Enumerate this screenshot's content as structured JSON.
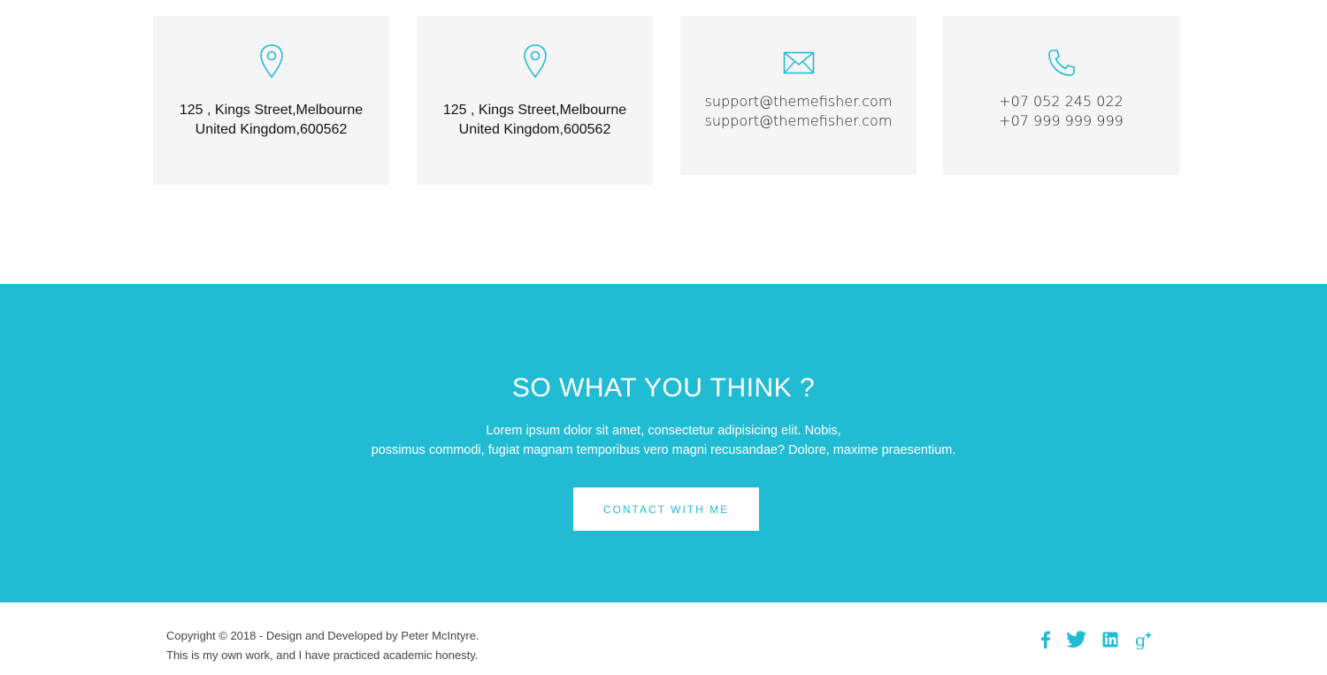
{
  "contact_cards": [
    {
      "icon": "map-marker-icon",
      "lines": [
        "125 , Kings Street,Melbourne",
        "United Kingdom,600562"
      ]
    },
    {
      "icon": "map-marker-icon",
      "lines": [
        "125 , Kings Street,Melbourne",
        "United Kingdom,600562"
      ]
    },
    {
      "icon": "envelope-icon",
      "lines": [
        "support@themefisher.com",
        "support@themefisher.com"
      ]
    },
    {
      "icon": "phone-icon",
      "lines": [
        "+07 052 245 022",
        "+07 999 999 999"
      ]
    }
  ],
  "cta": {
    "title": "SO WHAT YOU THINK ?",
    "text_line1": "Lorem ipsum dolor sit amet, consectetur adipisicing elit. Nobis,",
    "text_line2": "possimus commodi, fugiat magnam temporibus vero magni recusandae? Dolore, maxime praesentium.",
    "button_label": "CONTACT WITH ME"
  },
  "footer": {
    "copyright_line1": "Copyright © 2018 - Design and Developed by Peter McIntyre.",
    "copyright_line2": "This is my own work, and I have practiced academic honesty.",
    "social": [
      {
        "icon": "facebook-icon"
      },
      {
        "icon": "twitter-icon"
      },
      {
        "icon": "linkedin-icon"
      },
      {
        "icon": "google-plus-icon"
      }
    ]
  },
  "colors": {
    "accent": "#21bcd4",
    "card_bg": "#f5f5f5",
    "white": "#ffffff"
  }
}
